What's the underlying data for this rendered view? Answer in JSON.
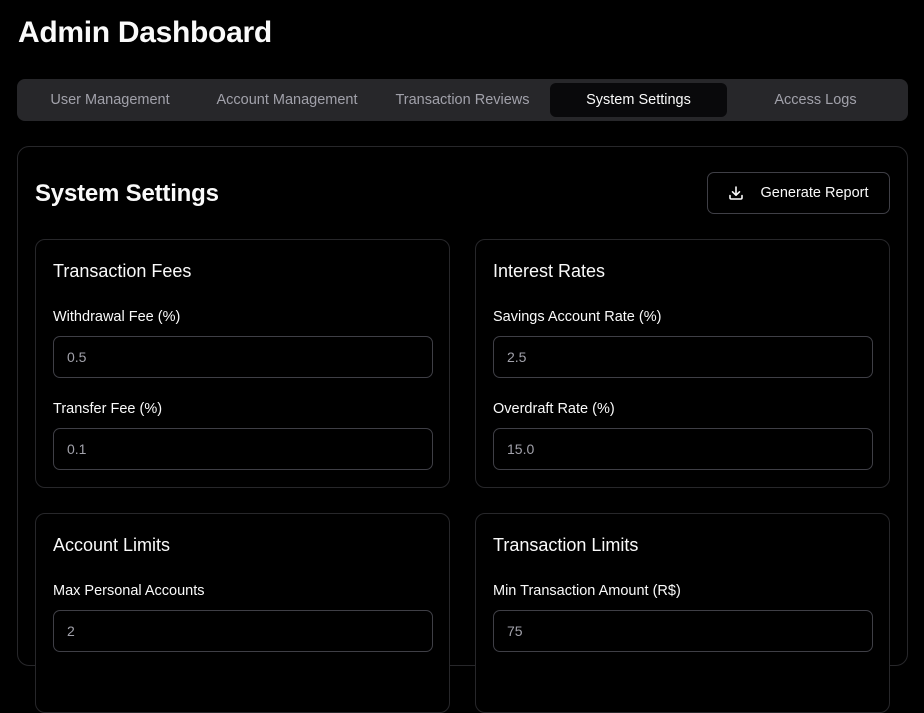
{
  "header": {
    "title": "Admin Dashboard"
  },
  "tabs": [
    {
      "label": "User Management",
      "active": false
    },
    {
      "label": "Account Management",
      "active": false
    },
    {
      "label": "Transaction Reviews",
      "active": false
    },
    {
      "label": "System Settings",
      "active": true
    },
    {
      "label": "Access Logs",
      "active": false
    }
  ],
  "panel": {
    "title": "System Settings",
    "report_button": {
      "label": "Generate Report",
      "icon": "download-icon"
    }
  },
  "cards": {
    "fees": {
      "title": "Transaction Fees",
      "fields": [
        {
          "label": "Withdrawal Fee (%)",
          "value": "0.5"
        },
        {
          "label": "Transfer Fee (%)",
          "value": "0.1"
        }
      ]
    },
    "interest": {
      "title": "Interest Rates",
      "fields": [
        {
          "label": "Savings Account Rate (%)",
          "value": "2.5"
        },
        {
          "label": "Overdraft Rate (%)",
          "value": "15.0"
        }
      ]
    },
    "account_limits": {
      "title": "Account Limits",
      "fields": [
        {
          "label": "Max Personal Accounts",
          "value": "2"
        }
      ]
    },
    "transaction_limits": {
      "title": "Transaction Limits",
      "fields": [
        {
          "label": "Min Transaction Amount (R$)",
          "value": "75"
        }
      ]
    }
  },
  "colors": {
    "background": "#000000",
    "tab_bar": "#27272a",
    "active_tab": "#09090b",
    "border": "#3f3f46",
    "muted_text": "#a1a1aa"
  }
}
